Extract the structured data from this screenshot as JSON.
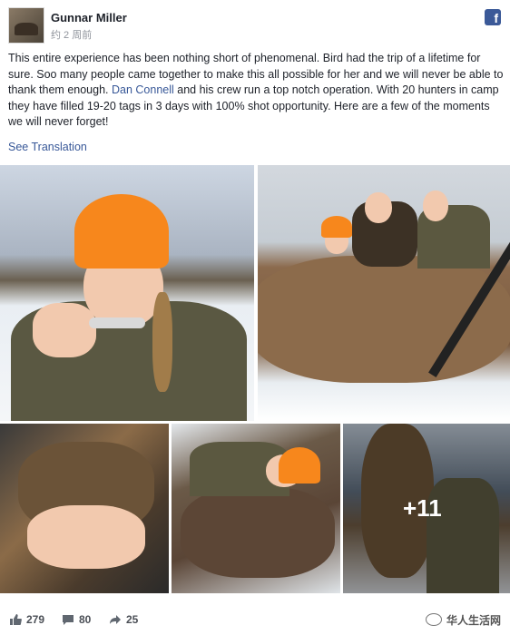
{
  "post": {
    "author": "Gunnar Miller",
    "time": "约 2 周前",
    "text_before_link": "This entire experience has been nothing short of phenomenal. Bird had the trip of a lifetime for sure. Soo many people came together to make this all possible for her and we will never be able to thank them enough. ",
    "link_text": "Dan Connell",
    "text_after_link": " and his crew run a top notch operation. With 20 hunters in camp they have filled 19-20 tags in 3 days with 100% shot opportunity. Here are a few of the moments we will never forget!",
    "see_translation": "See Translation"
  },
  "photos": {
    "more_count": "+11"
  },
  "stats": {
    "likes": "279",
    "comments": "80",
    "shares": "25"
  },
  "watermark": "华人生活网",
  "colors": {
    "link": "#385898",
    "facebook_blue": "#3b5998",
    "orange_hat": "#f7871c"
  },
  "icons": [
    "facebook-icon",
    "like-icon",
    "comment-icon",
    "share-icon"
  ]
}
